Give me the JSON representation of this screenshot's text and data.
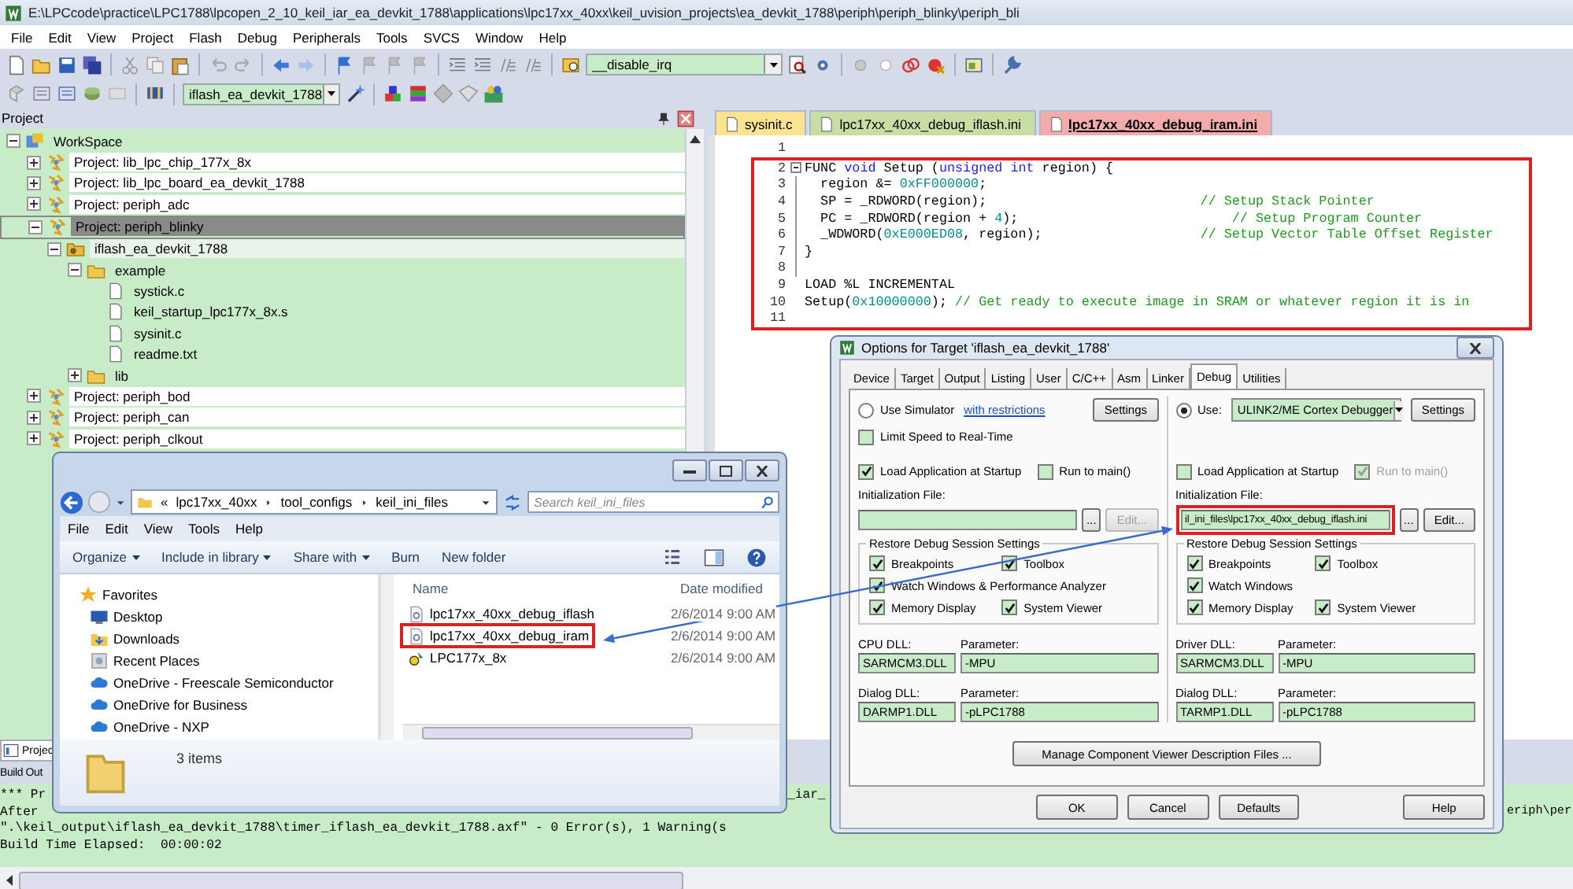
{
  "window": {
    "title": "E:\\LPCcode\\practice\\LPC1788\\lpcopen_2_10_keil_iar_ea_devkit_1788\\applications\\lpc17xx_40xx\\keil_uvision_projects\\ea_devkit_1788\\periph\\periph_blinky\\periph_bli"
  },
  "menu": [
    "File",
    "Edit",
    "View",
    "Project",
    "Flash",
    "Debug",
    "Peripherals",
    "Tools",
    "SVCS",
    "Window",
    "Help"
  ],
  "toolbar": {
    "function_combo": "__disable_irq",
    "target_combo": "iflash_ea_devkit_1788"
  },
  "project_panel": {
    "title": "Project",
    "tree": [
      {
        "kind": "workspace",
        "label": "WorkSpace",
        "expanded": true,
        "selected": false,
        "children": [
          {
            "kind": "project",
            "label": "Project: lib_lpc_chip_177x_8x",
            "expanded": false,
            "selected": false
          },
          {
            "kind": "project",
            "label": "Project: lib_lpc_board_ea_devkit_1788",
            "expanded": false,
            "selected": false
          },
          {
            "kind": "project",
            "label": "Project: periph_adc",
            "expanded": false,
            "selected": false
          },
          {
            "kind": "project",
            "label": "Project: periph_blinky",
            "expanded": true,
            "selected": true,
            "children": [
              {
                "kind": "target",
                "label": "iflash_ea_devkit_1788",
                "expanded": true,
                "selected": false,
                "children": [
                  {
                    "kind": "folder",
                    "label": "example",
                    "expanded": true,
                    "selected": false,
                    "children": [
                      {
                        "kind": "file",
                        "label": "systick.c",
                        "selected": false
                      },
                      {
                        "kind": "file",
                        "label": "keil_startup_lpc177x_8x.s",
                        "selected": false
                      },
                      {
                        "kind": "file",
                        "label": "sysinit.c",
                        "selected": false
                      },
                      {
                        "kind": "file",
                        "label": "readme.txt",
                        "selected": false
                      }
                    ]
                  },
                  {
                    "kind": "folder",
                    "label": "lib",
                    "expanded": false,
                    "selected": false
                  }
                ]
              }
            ]
          },
          {
            "kind": "project",
            "label": "Project: periph_bod",
            "expanded": false,
            "selected": false
          },
          {
            "kind": "project",
            "label": "Project: periph_can",
            "expanded": false,
            "selected": false
          },
          {
            "kind": "project",
            "label": "Project: periph_clkout",
            "expanded": false,
            "selected": false
          }
        ]
      }
    ]
  },
  "editor": {
    "tabs": [
      {
        "label": "sysinit.c",
        "color": "#fbe38f",
        "selected": false
      },
      {
        "label": "lpc17xx_40xx_debug_iflash.ini",
        "color": "#c9dea4",
        "selected": false
      },
      {
        "label": "lpc17xx_40xx_debug_iram.ini",
        "color": "#f4abab",
        "selected": true
      }
    ],
    "lines": [
      {
        "number": "1"
      }
    ],
    "highlighted_lines": [
      {
        "number": "2",
        "fold_expanded": true,
        "tokens": [
          {
            "text": "FUNC ",
            "kind": "plain"
          },
          {
            "text": "void",
            "kind": "keyword"
          },
          {
            "text": " Setup (",
            "kind": "plain"
          },
          {
            "text": "unsigned int",
            "kind": "keyword"
          },
          {
            "text": " region) {",
            "kind": "plain"
          }
        ]
      },
      {
        "number": "3",
        "in_fold": true,
        "tokens": [
          {
            "text": "  region &= ",
            "kind": "plain"
          },
          {
            "text": "0xFF000000",
            "kind": "number"
          },
          {
            "text": ";",
            "kind": "plain"
          }
        ]
      },
      {
        "number": "4",
        "in_fold": true,
        "tokens": [
          {
            "text": "  SP = _RDWORD(region);                           ",
            "kind": "plain"
          },
          {
            "text": "// Setup Stack Pointer",
            "kind": "comment"
          }
        ]
      },
      {
        "number": "5",
        "in_fold": true,
        "tokens": [
          {
            "text": "  PC = _RDWORD(region + ",
            "kind": "plain"
          },
          {
            "text": "4",
            "kind": "number"
          },
          {
            "text": ");                           ",
            "kind": "plain"
          },
          {
            "text": "// Setup Program Counter",
            "kind": "comment"
          }
        ]
      },
      {
        "number": "6",
        "in_fold": true,
        "tokens": [
          {
            "text": "  _WDWORD(",
            "kind": "plain"
          },
          {
            "text": "0xE000ED08",
            "kind": "number"
          },
          {
            "text": ", region);                    ",
            "kind": "plain"
          },
          {
            "text": "// Setup Vector Table Offset Register",
            "kind": "comment"
          }
        ]
      },
      {
        "number": "7",
        "in_fold": true,
        "tokens": [
          {
            "text": "}",
            "kind": "plain"
          }
        ]
      },
      {
        "number": "8",
        "in_fold": true
      },
      {
        "number": "9",
        "tokens": [
          {
            "text": "LOAD %L INCREMENTAL",
            "kind": "plain"
          }
        ]
      },
      {
        "number": "10",
        "tokens": [
          {
            "text": "Setup(",
            "kind": "plain"
          },
          {
            "text": "0x10000000",
            "kind": "number"
          },
          {
            "text": "); ",
            "kind": "plain"
          },
          {
            "text": "// Get ready to execute image in SRAM or whatever region it is in",
            "kind": "comment"
          }
        ]
      },
      {
        "number": "11"
      }
    ]
  },
  "bottom_tabs": [
    {
      "label": "Projec"
    }
  ],
  "build_output": {
    "title": "Build Out",
    "lines": [
      {
        "text": "*** Pr",
        "middle": "_iar_"
      },
      {
        "text": "After",
        "end": "eriph\\per"
      },
      {
        "text": "\".\\keil_output\\iflash_ea_devkit_1788\\timer_iflash_ea_devkit_1788.axf\" - 0 Error(s), 1 Warning(s"
      },
      {
        "text": "Build Time Elapsed:  00:00:02"
      }
    ]
  },
  "explorer": {
    "overflow": "«",
    "breadcrumbs": [
      "lpc17xx_40xx",
      "tool_configs",
      "keil_ini_files"
    ],
    "search_placeholder": "Search keil_ini_files",
    "menu": [
      "File",
      "Edit",
      "View",
      "Tools",
      "Help"
    ],
    "commands": [
      {
        "label": "Organize",
        "dropdown": true
      },
      {
        "label": "Include in library",
        "dropdown": true
      },
      {
        "label": "Share with",
        "dropdown": true
      },
      {
        "label": "Burn",
        "dropdown": false
      },
      {
        "label": "New folder",
        "dropdown": false
      }
    ],
    "nav": [
      {
        "label": "Favorites",
        "kind": "favorites"
      },
      {
        "label": "Desktop",
        "kind": "desktop"
      },
      {
        "label": "Downloads",
        "kind": "downloads"
      },
      {
        "label": "Recent Places",
        "kind": "recent"
      },
      {
        "label": "OneDrive - Freescale Semiconductor",
        "kind": "cloud"
      },
      {
        "label": "OneDrive for Business",
        "kind": "cloud"
      },
      {
        "label": "OneDrive - NXP",
        "kind": "cloud"
      }
    ],
    "columns": [
      "Name",
      "Date modified"
    ],
    "files": [
      {
        "name": "lpc17xx_40xx_debug_iflash",
        "date": "2/6/2014 9:00 AM",
        "kind": "settings",
        "boxed": false
      },
      {
        "name": "lpc17xx_40xx_debug_iram",
        "date": "2/6/2014 9:00 AM",
        "kind": "settings",
        "boxed": true
      },
      {
        "name": "LPC177x_8x",
        "date": "2/6/2014 9:00 AM",
        "kind": "device",
        "boxed": false
      }
    ],
    "status": "3 items"
  },
  "options_dialog": {
    "title": "Options for Target 'iflash_ea_devkit_1788'",
    "tabs": [
      {
        "label": "Device",
        "selected": false
      },
      {
        "label": "Target",
        "selected": false
      },
      {
        "label": "Output",
        "selected": false
      },
      {
        "label": "Listing",
        "selected": false
      },
      {
        "label": "User",
        "selected": false
      },
      {
        "label": "C/C++",
        "selected": false
      },
      {
        "label": "Asm",
        "selected": false
      },
      {
        "label": "Linker",
        "selected": false
      },
      {
        "label": "Debug",
        "selected": true
      },
      {
        "label": "Utilities",
        "selected": false
      }
    ],
    "columns": [
      {
        "mode": {
          "label": "Use Simulator",
          "selected": false
        },
        "link": "with restrictions",
        "settings_button": "Settings",
        "limit_speed": {
          "label": "Limit Speed to Real-Time",
          "checked": false,
          "disabled": false
        },
        "load_app": {
          "label": "Load Application at Startup",
          "checked": true,
          "disabled": false
        },
        "run_to_main": {
          "label": "Run to main()",
          "checked": false,
          "disabled": false
        },
        "init_label": "Initialization File:",
        "init_boxed": false,
        "browse_button": "...",
        "edit_button": {
          "label": "Edit...",
          "disabled": true
        },
        "restore": {
          "title": "Restore Debug Session Settings",
          "items": [
            {
              "label": "Breakpoints",
              "checked": true
            },
            {
              "label": "Toolbox",
              "checked": true
            },
            {
              "label": "Watch Windows & Performance Analyzer",
              "checked": true
            },
            {
              "label": "Memory Display",
              "checked": true
            },
            {
              "label": "System Viewer",
              "checked": true
            }
          ]
        },
        "dlls": [
          {
            "label": "CPU DLL:",
            "value": "SARMCM3.DLL",
            "param_label": "Parameter:",
            "param": "-MPU"
          },
          {
            "label": "Dialog DLL:",
            "value": "DARMP1.DLL",
            "param_label": "Parameter:",
            "param": "-pLPC1788"
          }
        ]
      },
      {
        "mode": {
          "label": "Use:",
          "selected": true
        },
        "debugger": "ULINK2/ME Cortex Debugger",
        "settings_button": "Settings",
        "load_app": {
          "label": "Load Application at Startup",
          "checked": false,
          "disabled": false
        },
        "run_to_main": {
          "label": "Run to main()",
          "checked": true,
          "disabled": true
        },
        "init_label": "Initialization File:",
        "init_value": "il_ini_files\\lpc17xx_40xx_debug_iflash.ini",
        "init_boxed": true,
        "browse_button": "...",
        "edit_button": {
          "label": "Edit...",
          "disabled": false
        },
        "restore": {
          "title": "Restore Debug Session Settings",
          "items": [
            {
              "label": "Breakpoints",
              "checked": true
            },
            {
              "label": "Toolbox",
              "checked": true
            },
            {
              "label": "Watch Windows",
              "checked": true
            },
            {
              "label": "Memory Display",
              "checked": true
            },
            {
              "label": "System Viewer",
              "checked": true
            }
          ]
        },
        "dlls": [
          {
            "label": "Driver DLL:",
            "value": "SARMCM3.DLL",
            "param_label": "Parameter:",
            "param": "-MPU"
          },
          {
            "label": "Dialog DLL:",
            "value": "TARMP1.DLL",
            "param_label": "Parameter:",
            "param": "-pLPC1788"
          }
        ]
      }
    ],
    "manage_button": "Manage Component Viewer Description Files ...",
    "buttons": [
      "OK",
      "Cancel",
      "Defaults",
      "Help"
    ]
  }
}
